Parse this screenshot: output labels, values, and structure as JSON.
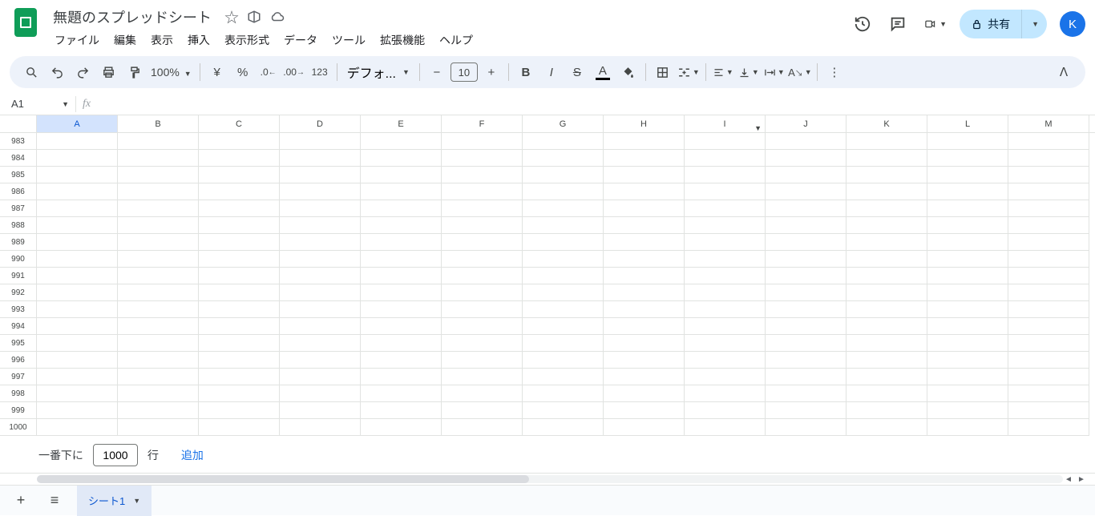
{
  "doc": {
    "title": "無題のスプレッドシート"
  },
  "menu": {
    "file": "ファイル",
    "edit": "編集",
    "view": "表示",
    "insert": "挿入",
    "format": "表示形式",
    "data": "データ",
    "tools": "ツール",
    "extensions": "拡張機能",
    "help": "ヘルプ"
  },
  "share": {
    "label": "共有"
  },
  "avatar": {
    "initial": "K"
  },
  "toolbar": {
    "zoom": "100%",
    "currency": "¥",
    "percent": "%",
    "digits": "123",
    "font": "デフォ...",
    "fontsize": "10"
  },
  "namebox": {
    "value": "A1"
  },
  "columns": [
    "A",
    "B",
    "C",
    "D",
    "E",
    "F",
    "G",
    "H",
    "I",
    "J",
    "K",
    "L",
    "M"
  ],
  "selectedCol": "A",
  "dropdownCol": "I",
  "rowStart": 983,
  "rowEnd": 1000,
  "addRows": {
    "prefix": "一番下に",
    "count": "1000",
    "suffix": "行",
    "action": "追加"
  },
  "sheet": {
    "name": "シート1"
  }
}
